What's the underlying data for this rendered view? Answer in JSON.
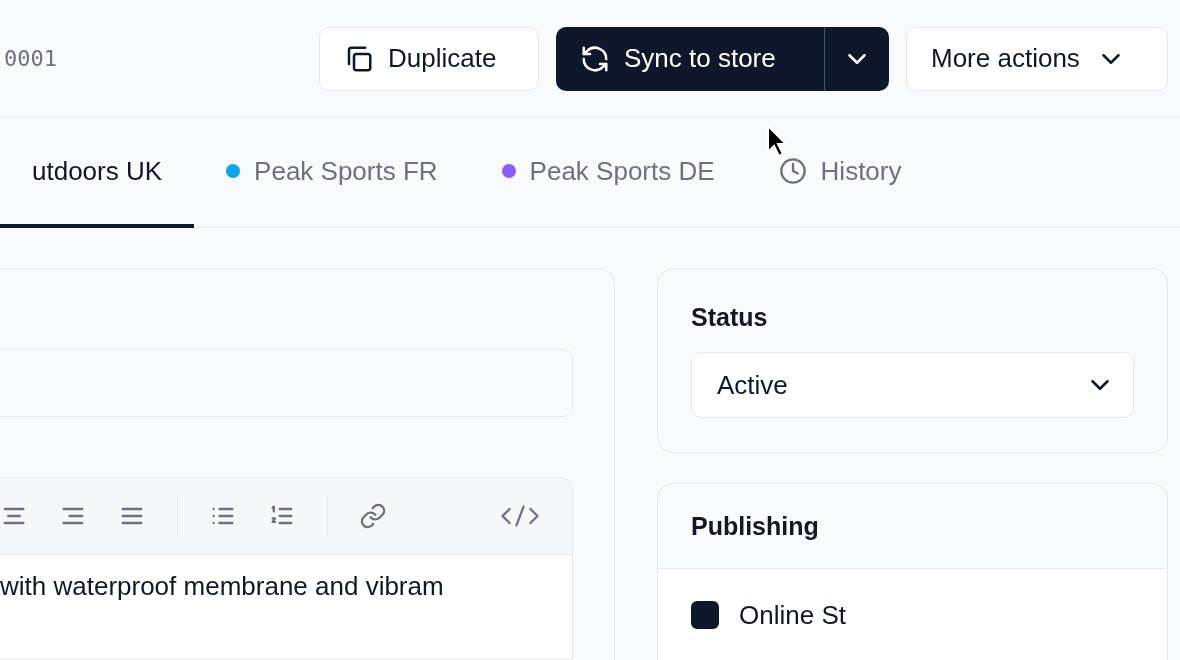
{
  "header": {
    "record_id": "0001",
    "duplicate": {
      "label": "Duplicate"
    },
    "sync": {
      "label": "Sync to store"
    },
    "more_actions": {
      "label": "More actions"
    }
  },
  "tabs": [
    {
      "label": "utdoors UK",
      "selected": true,
      "kind": "plain"
    },
    {
      "label": "Peak Sports FR",
      "selected": false,
      "kind": "store",
      "color": "#0ea5e9"
    },
    {
      "label": "Peak Sports DE",
      "selected": false,
      "kind": "store",
      "color": "#8b5cf6"
    },
    {
      "label": "History",
      "selected": false,
      "kind": "history"
    }
  ],
  "editor": {
    "body": "with waterproof membrane and vibram"
  },
  "status": {
    "title": "Status",
    "value": "Active"
  },
  "publishing": {
    "title": "Publishing",
    "channels": [
      {
        "label": "Online St",
        "checked": true
      }
    ]
  }
}
